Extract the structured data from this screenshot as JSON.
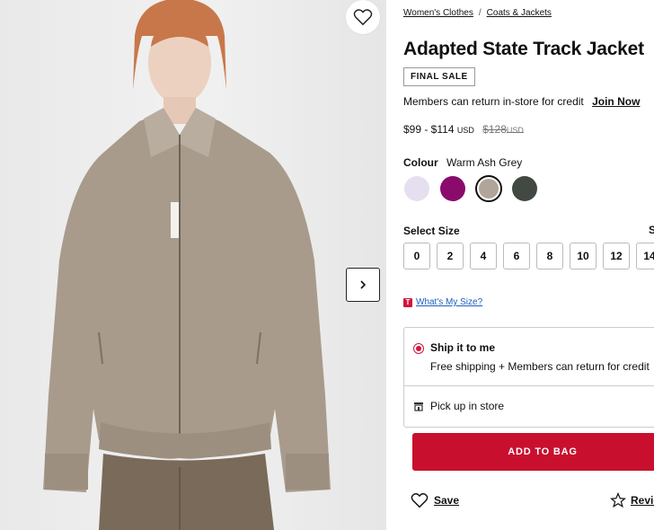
{
  "breadcrumb": {
    "items": [
      "Women's Clothes",
      "Coats & Jackets"
    ],
    "separator": "/"
  },
  "product": {
    "title": "Adapted State Track Jacket",
    "badge": "FINAL SALE",
    "members_text": "Members can return in-store for credit",
    "join_label": "Join Now",
    "price_range": "$99 - $114",
    "price_currency": "USD",
    "original_price": "$128",
    "original_currency": "USD"
  },
  "colour": {
    "label": "Colour",
    "selected_name": "Warm Ash Grey",
    "swatches": [
      {
        "name": "lavender",
        "hex": "#e6dff0"
      },
      {
        "name": "purple",
        "hex": "#8a0b6b"
      },
      {
        "name": "warm-ash-grey",
        "hex": "#b0a598"
      },
      {
        "name": "dark-grey",
        "hex": "#424842"
      }
    ]
  },
  "size": {
    "label": "Select Size",
    "guide_label": "S",
    "options": [
      "0",
      "2",
      "4",
      "6",
      "8",
      "10",
      "12",
      "14"
    ],
    "whats_my_size": "What's My Size?"
  },
  "shipping": {
    "ship_title": "Ship it to me",
    "ship_sub": "Free shipping + Members can return for credit",
    "pickup_label": "Pick up in store"
  },
  "actions": {
    "add_to_bag": "ADD TO BAG",
    "save": "Save",
    "reviews": "Revie"
  },
  "colors": {
    "accent": "#c8102e",
    "jacket": "#a89b8c"
  }
}
